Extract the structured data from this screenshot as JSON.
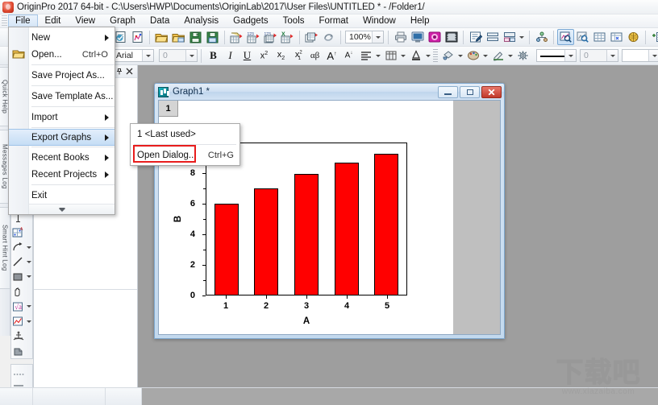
{
  "window": {
    "title": "OriginPro 2017 64-bit - C:\\Users\\HWP\\Documents\\OriginLab\\2017\\User Files\\UNTITLED * - /Folder1/",
    "app_icon": "origin-app-icon"
  },
  "menubar": {
    "items": [
      {
        "label": "File",
        "active": true
      },
      {
        "label": "Edit",
        "active": false
      },
      {
        "label": "View",
        "active": false
      },
      {
        "label": "Graph",
        "active": false
      },
      {
        "label": "Data",
        "active": false
      },
      {
        "label": "Analysis",
        "active": false
      },
      {
        "label": "Gadgets",
        "active": false
      },
      {
        "label": "Tools",
        "active": false
      },
      {
        "label": "Format",
        "active": false
      },
      {
        "label": "Window",
        "active": false
      },
      {
        "label": "Help",
        "active": false
      }
    ]
  },
  "file_menu": {
    "items": [
      {
        "label": "New",
        "shortcut": "",
        "submenu": true,
        "highlighted": false,
        "icon": ""
      },
      {
        "label": "Open...",
        "shortcut": "Ctrl+O",
        "submenu": false,
        "highlighted": false,
        "icon": "open-folder-icon"
      },
      {
        "label": "Save Project As...",
        "shortcut": "",
        "submenu": false,
        "highlighted": false,
        "icon": ""
      },
      {
        "label": "Save Template As...",
        "shortcut": "",
        "submenu": false,
        "highlighted": false,
        "icon": ""
      },
      {
        "label": "Import",
        "shortcut": "",
        "submenu": true,
        "highlighted": false,
        "icon": ""
      },
      {
        "label": "Export Graphs",
        "shortcut": "",
        "submenu": true,
        "highlighted": true,
        "icon": ""
      },
      {
        "label": "Recent Books",
        "shortcut": "",
        "submenu": true,
        "highlighted": false,
        "icon": ""
      },
      {
        "label": "Recent Projects",
        "shortcut": "",
        "submenu": true,
        "highlighted": false,
        "icon": ""
      },
      {
        "label": "Exit",
        "shortcut": "",
        "submenu": false,
        "highlighted": false,
        "icon": ""
      }
    ],
    "expander_icon": "double-chevron-down-icon"
  },
  "export_submenu": {
    "items": [
      {
        "label": "1 <Last used>",
        "shortcut": "",
        "highlighted": false
      },
      {
        "label": "Open Dialog...",
        "shortcut": "Ctrl+G",
        "highlighted": true
      }
    ],
    "highlight_color": "#e81d1d"
  },
  "toolbar_top": {
    "zoom_value": "100%",
    "zoom_placeholder": "100%"
  },
  "toolbar_format": {
    "font_value": "Arial",
    "font_placeholder": "Arial",
    "size_value": "0",
    "line_width_value": "0",
    "trailing_value": "0",
    "buttons": [
      "bold",
      "italic",
      "underline",
      "superscript",
      "subscript",
      "super-subscript",
      "greek",
      "increase-font",
      "decrease-font",
      "align",
      "table",
      "font-color",
      "fill-color",
      "palette",
      "pen",
      "gear"
    ]
  },
  "left_dock": {
    "tabs": [
      "Quick Help",
      "Messages Log",
      "Smart Hint Log"
    ]
  },
  "tool_palette": {
    "tools": [
      "text-tool-icon",
      "draw-data-icon",
      "arrow-tool-icon",
      "line-tool-icon",
      "rectangle-tool-icon",
      "hand-tool-icon",
      "math-equation-icon",
      "region-select-icon",
      "screen-reader-icon",
      "data-cursor-icon"
    ]
  },
  "explorer": {
    "pin_icon": "pin-icon",
    "close_icon": "close-icon"
  },
  "graph_window": {
    "title": "Graph1 *",
    "icon": "graph-window-icon",
    "layer_tab": "1",
    "minimize_label": "–",
    "maximize_label": "□",
    "close_label": "✕"
  },
  "chart_data": {
    "type": "bar",
    "title": "",
    "categories": [
      "1",
      "2",
      "3",
      "4",
      "5"
    ],
    "values": [
      6,
      7,
      8,
      8.7,
      9.3
    ],
    "xlabel": "A",
    "ylabel": "B",
    "ylim": [
      0,
      10
    ],
    "yticks": [
      0,
      2,
      4,
      6,
      8
    ],
    "ytick_labels": [
      "0",
      "2",
      "4",
      "6",
      "8"
    ],
    "xtick_labels": [
      "1",
      "2",
      "3",
      "4",
      "5"
    ],
    "bar_color": "#ff0000",
    "bar_border_color": "#000000",
    "grid": false,
    "legend": false
  },
  "watermark": {
    "text_cn": "下载吧",
    "text_url": "www.xiazaiba.com"
  }
}
